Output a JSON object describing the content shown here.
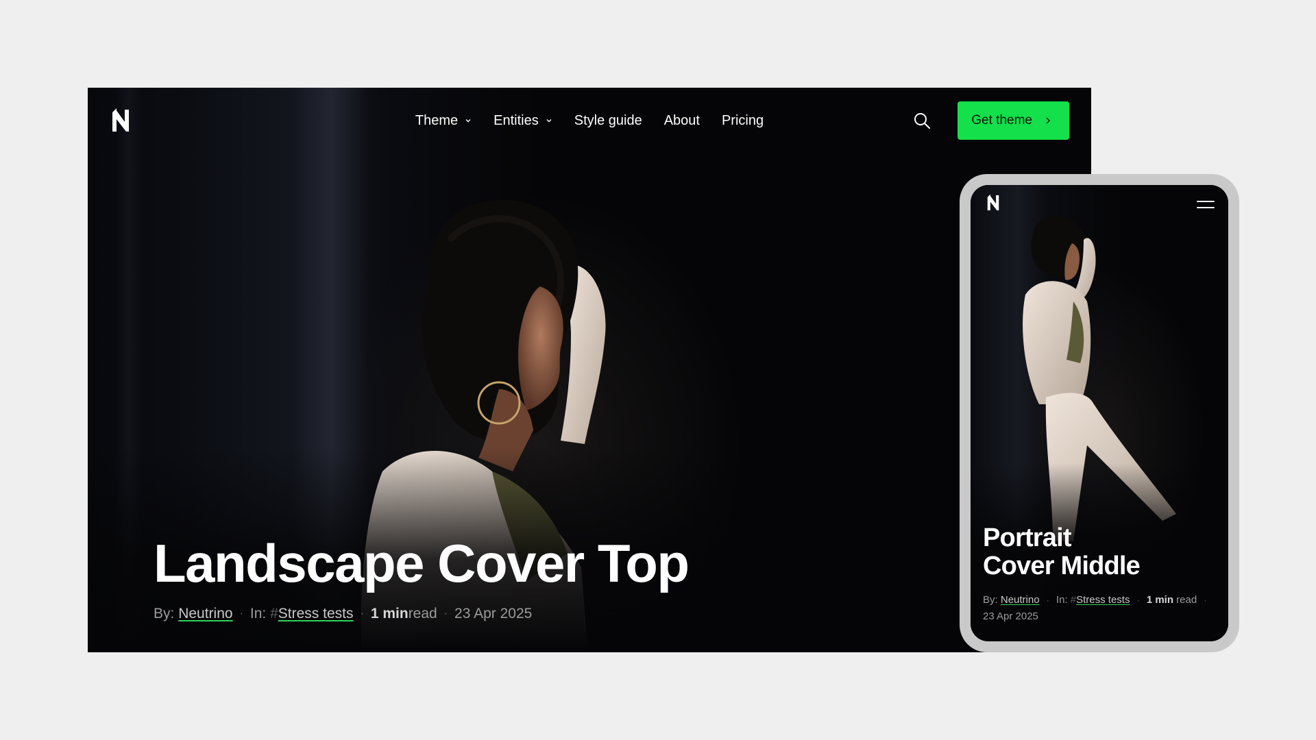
{
  "desktop": {
    "logo_icon": "neutrino-logo-icon",
    "nav": {
      "theme": "Theme",
      "entities": "Entities",
      "style_guide": "Style guide",
      "about": "About",
      "pricing": "Pricing"
    },
    "search_icon": "search-icon",
    "cta_label": "Get theme",
    "hero": {
      "title": "Landscape Cover Top",
      "by_label": "By:",
      "author": "Neutrino",
      "in_label": "In:",
      "hash": "#",
      "tag": "Stress tests",
      "read_time_bold": "1 min",
      "read_time_rest": " read",
      "date": "23 Apr 2025"
    }
  },
  "mobile": {
    "logo_icon": "neutrino-logo-icon",
    "menu_icon": "hamburger-menu-icon",
    "hero": {
      "title_line1": "Portrait",
      "title_line2": "Cover Middle",
      "by_label": "By:",
      "author": "Neutrino",
      "in_label": "In:",
      "hash": "#",
      "tag": "Stress tests",
      "read_time_bold": "1 min",
      "read_time_rest": " read",
      "date": "23 Apr 2025"
    }
  },
  "colors": {
    "page_background": "#efefef",
    "hero_background": "#050507",
    "accent_green": "#13e04a",
    "phone_frame": "#c9c9c9"
  }
}
